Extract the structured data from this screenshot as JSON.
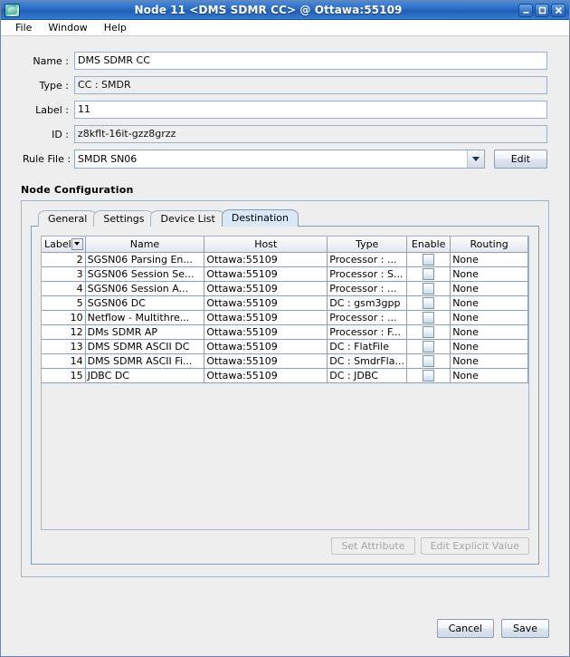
{
  "window": {
    "title": "Node 11 <DMS SDMR CC> @ Ottawa:55109",
    "app_icon": "node-app-icon",
    "controls": {
      "minimize": "minimize-icon",
      "maximize": "maximize-icon",
      "close": "close-icon"
    }
  },
  "menubar": {
    "items": [
      {
        "label": "File"
      },
      {
        "label": "Window"
      },
      {
        "label": "Help"
      }
    ]
  },
  "form": {
    "name": {
      "label": "Name :",
      "value": "DMS SDMR CC"
    },
    "type": {
      "label": "Type :",
      "value": "CC : SMDR"
    },
    "label": {
      "label": "Label :",
      "value": "11"
    },
    "id": {
      "label": "ID :",
      "value": "z8kflt-16it-gzz8grzz"
    },
    "rule_file": {
      "label": "Rule File :",
      "value": "SMDR SN06",
      "edit_button": "Edit"
    }
  },
  "node_configuration": {
    "title": "Node Configuration",
    "tabs": [
      {
        "label": "General",
        "active": false
      },
      {
        "label": "Settings",
        "active": false
      },
      {
        "label": "Device List",
        "active": false
      },
      {
        "label": "Destination",
        "active": true
      }
    ],
    "table": {
      "columns": [
        "Label",
        "Name",
        "Host",
        "Type",
        "Enable",
        "Routing"
      ],
      "sort_column": "Label",
      "sort_direction": "descending",
      "rows": [
        {
          "label": "2",
          "name": "SGSN06 Parsing En...",
          "host": "Ottawa:55109",
          "type": "Processor : ...",
          "enable": false,
          "routing": "None"
        },
        {
          "label": "3",
          "name": "SGSN06 Session Se...",
          "host": "Ottawa:55109",
          "type": "Processor : S...",
          "enable": false,
          "routing": "None"
        },
        {
          "label": "4",
          "name": "SGSN06 Session A...",
          "host": "Ottawa:55109",
          "type": "Processor : ...",
          "enable": false,
          "routing": "None"
        },
        {
          "label": "5",
          "name": "SGSN06 DC",
          "host": "Ottawa:55109",
          "type": "DC : gsm3gpp",
          "enable": false,
          "routing": "None"
        },
        {
          "label": "10",
          "name": "Netflow - Multithre...",
          "host": "Ottawa:55109",
          "type": "Processor : ...",
          "enable": false,
          "routing": "None"
        },
        {
          "label": "12",
          "name": "DMs SDMR AP",
          "host": "Ottawa:55109",
          "type": "Processor : F...",
          "enable": false,
          "routing": "None"
        },
        {
          "label": "13",
          "name": "DMS SDMR ASCII DC",
          "host": "Ottawa:55109",
          "type": "DC : FlatFile",
          "enable": false,
          "routing": "None"
        },
        {
          "label": "14",
          "name": "DMS SDMR ASCII Fi...",
          "host": "Ottawa:55109",
          "type": "DC : SmdrFla...",
          "enable": false,
          "routing": "None"
        },
        {
          "label": "15",
          "name": "JDBC DC",
          "host": "Ottawa:55109",
          "type": "DC : JDBC",
          "enable": false,
          "routing": "None"
        }
      ]
    },
    "actions": [
      {
        "label": "Set Attribute",
        "enabled": false
      },
      {
        "label": "Edit Explicit Value",
        "enabled": false
      }
    ]
  },
  "footer": {
    "cancel": "Cancel",
    "save": "Save"
  },
  "colors": {
    "titlebar": "#2b6cc4",
    "panel_bg": "#eeeeee",
    "active_tab": "#d8e8f6",
    "border": "#9fb3cc",
    "grid_line": "#8ca0b8"
  }
}
